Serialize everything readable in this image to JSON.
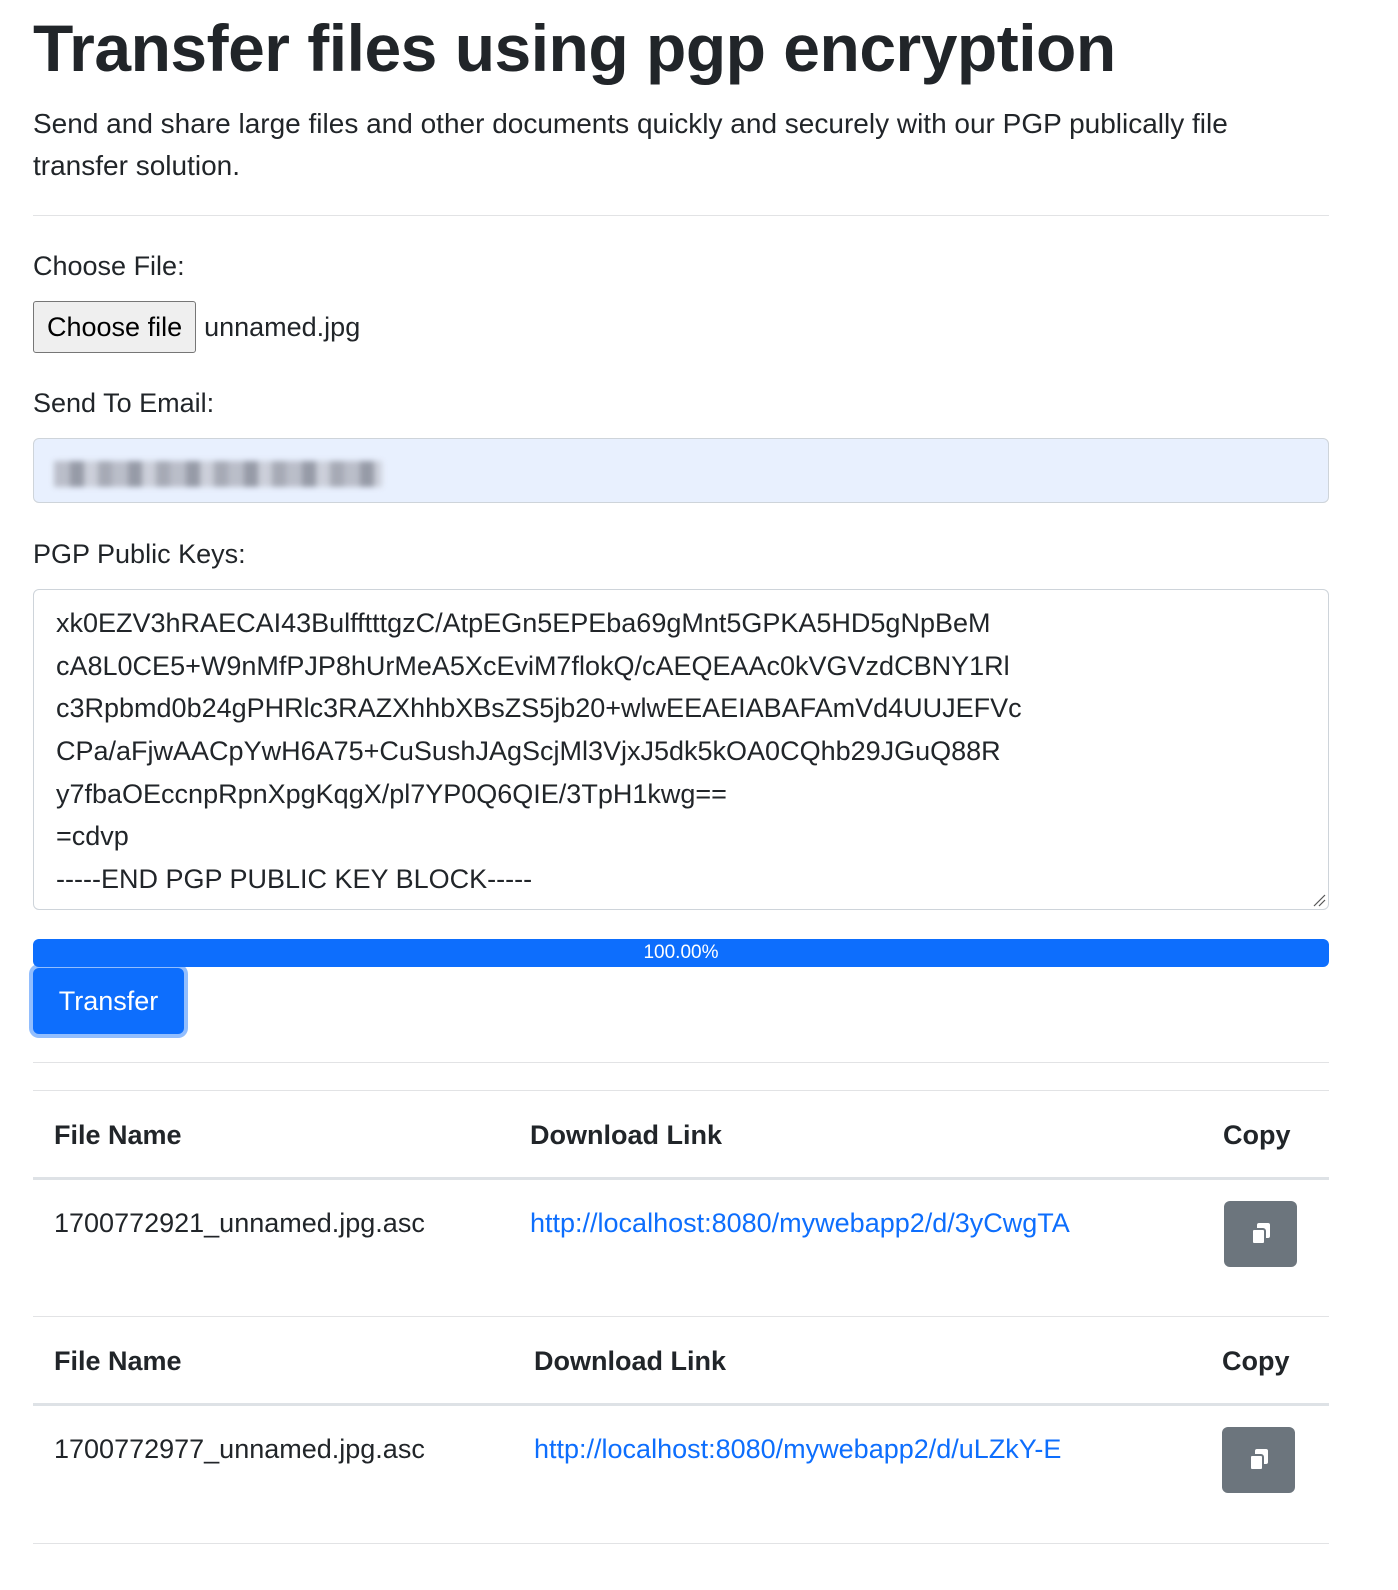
{
  "header": {
    "title": "Transfer files using pgp encryption",
    "lead": "Send and share large files and other documents quickly and securely with our PGP publically file transfer solution."
  },
  "form": {
    "file_label": "Choose File:",
    "file_button": "Choose file",
    "file_name": "unnamed.jpg",
    "email_label": "Send To Email:",
    "email_value": "",
    "keys_label": "PGP Public Keys:",
    "keys_lines": [
      "xk0EZV3hRAECAI43BulfftttgzC/AtpEGn5EPEba69gMnt5GPKA5HD5gNpBeM",
      "cA8L0CE5+W9nMfPJP8hUrMeA5XcEviM7flokQ/cAEQEAAc0kVGVzdCBNY1Rl",
      "c3Rpbmd0b24gPHRlc3RAZXhhbXBsZS5jb20+wlwEEAEIABAFAmVd4UUJEFVc",
      "CPa/aFjwAACpYwH6A75+CuSushJAgScjMl3VjxJ5dk5kOA0CQhb29JGuQ88R",
      "y7fbaOEccnpRpnXpgKqgX/pl7YP0Q6QIE/3TpH1kwg==",
      "=cdvp",
      "-----END PGP PUBLIC KEY BLOCK-----"
    ],
    "progress_percent": 100,
    "progress_label": "100.00%",
    "transfer_button": "Transfer"
  },
  "results": [
    {
      "headers": {
        "file_name": "File Name",
        "download_link": "Download Link",
        "copy": "Copy"
      },
      "file_name": "1700772921_unnamed.jpg.asc",
      "link": "http://localhost:8080/mywebapp2/d/3yCwgTA"
    },
    {
      "headers": {
        "file_name": "File Name",
        "download_link": "Download Link",
        "copy": "Copy"
      },
      "file_name": "1700772977_unnamed.jpg.asc",
      "link": "http://localhost:8080/mywebapp2/d/uLZkY-E"
    }
  ],
  "colors": {
    "primary": "#0d6efd",
    "secondary": "#6c757d",
    "autofill_bg": "#e8f0fe"
  }
}
